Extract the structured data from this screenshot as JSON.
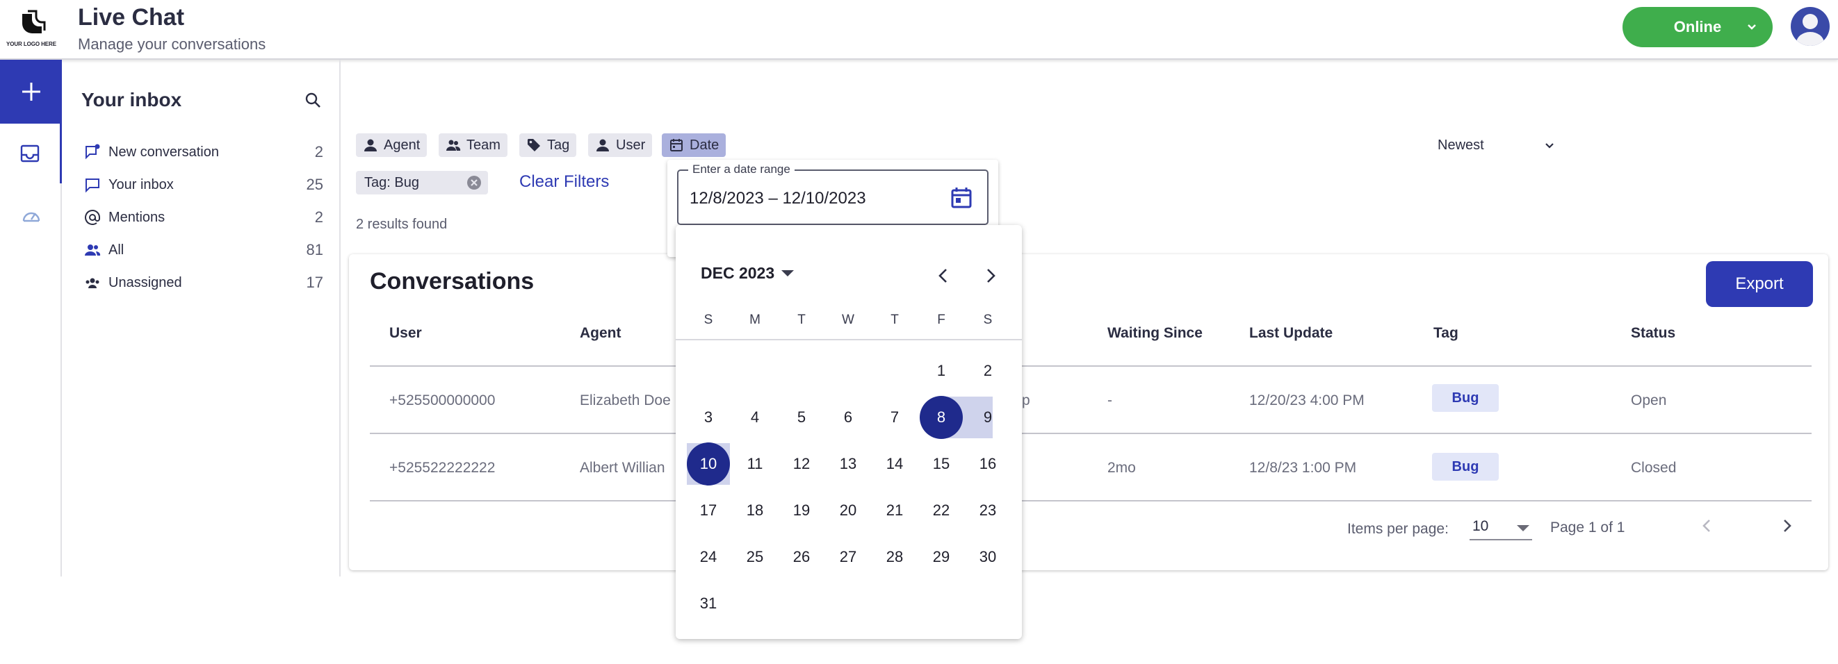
{
  "header": {
    "logo_text": "YOUR LOGO HERE",
    "title": "Live Chat",
    "subtitle": "Manage your conversations",
    "status_label": "Online",
    "status_color": "#3fae4c"
  },
  "rail": {
    "accent": "#2e3ab3",
    "icons": [
      "plus-icon",
      "inbox-icon",
      "dashboard-icon"
    ]
  },
  "inbox": {
    "title": "Your inbox",
    "items": [
      {
        "label": "New conversation",
        "count": "2",
        "icon": "new-chat-icon"
      },
      {
        "label": "Your inbox",
        "count": "25",
        "icon": "chat-icon"
      },
      {
        "label": "Mentions",
        "count": "2",
        "icon": "at-icon"
      },
      {
        "label": "All",
        "count": "81",
        "icon": "people-icon"
      },
      {
        "label": "Unassigned",
        "count": "17",
        "icon": "group-icon"
      }
    ]
  },
  "filters": {
    "chips": [
      {
        "label": "Agent",
        "icon": "person-icon"
      },
      {
        "label": "Team",
        "icon": "team-icon"
      },
      {
        "label": "Tag",
        "icon": "tag-icon"
      },
      {
        "label": "User",
        "icon": "person-icon"
      },
      {
        "label": "Date",
        "icon": "calendar-icon"
      }
    ],
    "active_tag": "Tag: Bug",
    "clear_label": "Clear Filters",
    "results": "2 results found",
    "sort": "Newest"
  },
  "date_range": {
    "legend": "Enter a date range",
    "value": "12/8/2023 – 12/10/2023"
  },
  "calendar": {
    "month_label": "DEC 2023",
    "weekdays": [
      "S",
      "M",
      "T",
      "W",
      "T",
      "F",
      "S"
    ],
    "days": [
      "1",
      "2",
      "3",
      "4",
      "5",
      "6",
      "7",
      "8",
      "9",
      "10",
      "11",
      "12",
      "13",
      "14",
      "15",
      "16",
      "17",
      "18",
      "19",
      "20",
      "21",
      "22",
      "23",
      "24",
      "25",
      "26",
      "27",
      "28",
      "29",
      "30",
      "31"
    ],
    "first_weekday": 5,
    "range_start": 8,
    "range_end": 10
  },
  "conversations": {
    "title": "Conversations",
    "export_label": "Export",
    "columns": [
      "User",
      "Agent",
      "Waiting Since",
      "Last Update",
      "Tag",
      "Status"
    ],
    "rows": [
      {
        "user": "+525500000000",
        "agent": "Elizabeth Doe",
        "partial": "p",
        "waiting": "-",
        "updated": "12/20/23  4:00 PM",
        "tag": "Bug",
        "status": "Open"
      },
      {
        "user": "+525522222222",
        "agent": "Albert Willian",
        "partial": "",
        "waiting": "2mo",
        "updated": "12/8/23  1:00 PM",
        "tag": "Bug",
        "status": "Closed"
      }
    ],
    "items_per_page_label": "Items per page:",
    "items_per_page": "10",
    "page_label": "Page 1 of 1"
  }
}
